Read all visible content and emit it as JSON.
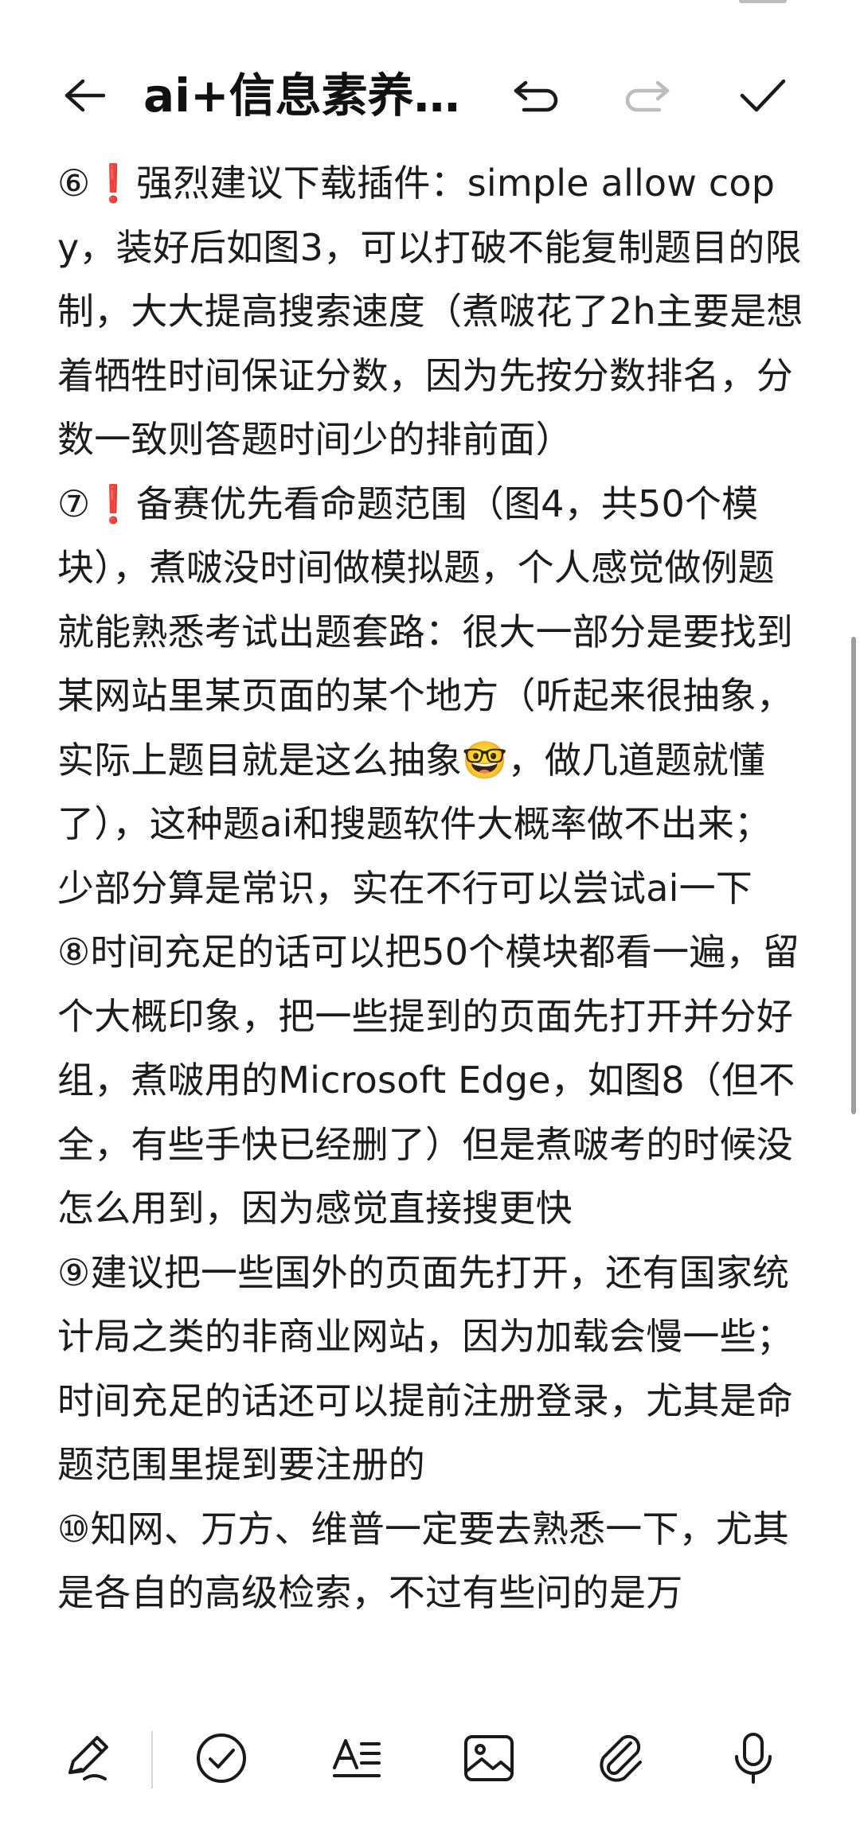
{
  "header": {
    "title": "ai+信息素养…",
    "back_icon": "arrow-left-icon",
    "undo_icon": "undo-icon",
    "redo_icon": "redo-icon",
    "done_icon": "checkmark-icon"
  },
  "body": {
    "paragraphs": [
      "⑥❗强烈建议下载插件：simple allow copy，装好后如图3，可以打破不能复制题目的限制，大大提高搜索速度（煮啵花了2h主要是想着牺牲时间保证分数，因为先按分数排名，分数一致则答题时间少的排前面）",
      "⑦❗备赛优先看命题范围（图4，共50个模块），煮啵没时间做模拟题，个人感觉做例题就能熟悉考试出题套路：很大一部分是要找到 某网站里某页面的某个地方（听起来很抽象，实际上题目就是这么抽象🤓，做几道题就懂了），这种题ai和搜题软件大概率做不出来；少部分算是常识，实在不行可以尝试ai一下",
      "⑧时间充足的话可以把50个模块都看一遍，留个大概印象，把一些提到的页面先打开并分好组，煮啵用的Microsoft Edge，如图8（但不全，有些手快已经删了）但是煮啵考的时候没怎么用到，因为感觉直接搜更快",
      "⑨建议把一些国外的页面先打开，还有国家统计局之类的非商业网站，因为加载会慢一些；时间充足的话还可以提前注册登录，尤其是命题范围里提到要注册的",
      "⑩知网、万方、维普一定要去熟悉一下，尤其是各自的高级检索，不过有些问的是万"
    ]
  },
  "toolbar": {
    "items": [
      "pen-icon",
      "check-circle-icon",
      "text-format-icon",
      "image-icon",
      "attachment-icon",
      "microphone-icon"
    ]
  },
  "colors": {
    "background": "#ffffff",
    "text": "#1c1c1c",
    "icon": "#1a1a1a",
    "disabled_icon": "#bdbdbd",
    "scrollbar": "#9e9e9e"
  }
}
